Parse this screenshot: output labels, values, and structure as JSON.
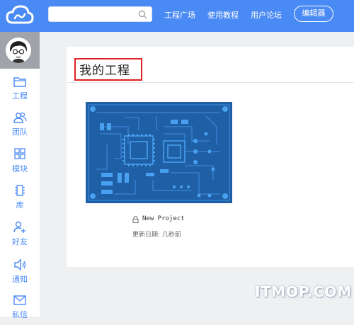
{
  "colors": {
    "brand": "#4a8af4",
    "highlight": "#e02020",
    "pcb": "#1f5fa6"
  },
  "header": {
    "search_placeholder": "",
    "nav": [
      "工程广场",
      "使用教程",
      "用户论坛"
    ],
    "editor_button": "编辑器"
  },
  "sidebar": {
    "items": [
      {
        "label": "工程",
        "icon": "folder-icon"
      },
      {
        "label": "团队",
        "icon": "team-icon"
      },
      {
        "label": "模块",
        "icon": "grid-icon"
      },
      {
        "label": "库",
        "icon": "chip-icon"
      },
      {
        "label": "好友",
        "icon": "add-friend-icon"
      },
      {
        "label": "通知",
        "icon": "speaker-icon"
      },
      {
        "label": "私信",
        "icon": "mail-icon"
      }
    ]
  },
  "main": {
    "title": "我的工程",
    "project": {
      "name": "New Project",
      "updated": "更新日期: 几秒前",
      "private": true
    }
  },
  "watermark": "ITMOP.COM"
}
